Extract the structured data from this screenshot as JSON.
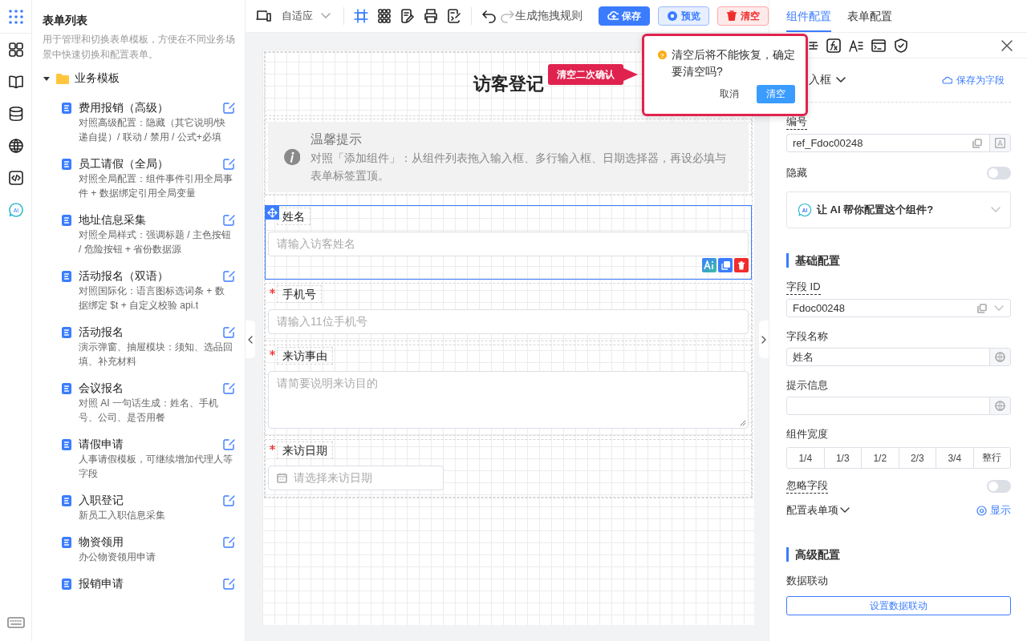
{
  "rail": {
    "ai_label": "AI"
  },
  "left_panel": {
    "title": "表单列表",
    "description": "用于管理和切换表单模板，方便在不同业务场景中快速切换和配置表单。",
    "folder": {
      "label": "业务模板",
      "expanded": true,
      "children": [
        {
          "title": "费用报销（高级）",
          "description": "对照高级配置：隐藏（其它说明/快递自提）/ 联动 / 禁用 / 公式+必填"
        },
        {
          "title": "员工请假（全局）",
          "description": "对照全局配置：组件事件引用全局事件 + 数据绑定引用全局变量"
        },
        {
          "title": "地址信息采集",
          "description": "对照全局样式：强调标题 / 主色按钮 / 危险按钮 + 省份数据源"
        },
        {
          "title": "活动报名（双语）",
          "description": "对照国际化：语言图标选词条 + 数据绑定 $t + 自定义校验 api.t"
        },
        {
          "title": "活动报名",
          "description": "演示弹窗、抽屉模块：须知、选品回填、补充材料"
        },
        {
          "title": "会议报名",
          "description": "对照 AI 一句话生成：姓名、手机号、公司、是否用餐"
        },
        {
          "title": "请假申请",
          "description": "人事请假模板，可继续增加代理人等字段"
        },
        {
          "title": "入职登记",
          "description": "新员工入职信息采集"
        },
        {
          "title": "物资领用",
          "description": "办公物资领用申请"
        },
        {
          "title": "报销申请"
        }
      ]
    }
  },
  "toolbar": {
    "layout_select": "自适应",
    "tools": [
      {
        "kind": "frame",
        "active": true
      },
      {
        "kind": "grid",
        "active": false
      },
      {
        "kind": "edit",
        "active": false
      },
      {
        "kind": "print",
        "active": false
      },
      {
        "kind": "script",
        "active": false
      }
    ],
    "history": [
      {
        "kind": "undo",
        "disabled": false
      },
      {
        "kind": "redo",
        "disabled": true
      }
    ],
    "generate_rule": "生成拖拽规则",
    "buttons": [
      {
        "kind": "save",
        "label": "保存"
      },
      {
        "kind": "preview",
        "label": "预览"
      },
      {
        "kind": "clear",
        "label": "清空"
      }
    ]
  },
  "form": {
    "title": "访客登记",
    "notice": {
      "title": "温馨提示",
      "text": "对照「添加组件」：从组件列表拖入输入框、多行输入框、日期选择器，再设必填与表单标签置顶。"
    },
    "fields": [
      {
        "kind": "input",
        "label": "姓名",
        "required": false,
        "selected": true,
        "placeholder": "请输入访客姓名"
      },
      {
        "kind": "input",
        "label": "手机号",
        "required": true,
        "selected": false,
        "placeholder": "请输入11位手机号"
      },
      {
        "kind": "textarea",
        "label": "来访事由",
        "required": true,
        "selected": false,
        "placeholder": "请简要说明来访目的"
      },
      {
        "kind": "date",
        "label": "来访日期",
        "required": true,
        "selected": false,
        "placeholder": "请选择来访日期"
      }
    ]
  },
  "popconfirm": {
    "icon": "?",
    "message": "清空后将不能恢复，确定要清空吗?",
    "cancel": "取消",
    "confirm": "清空"
  },
  "callout": "清空二次确认",
  "right_panel": {
    "tabs": [
      {
        "label": "组件配置",
        "selected": true
      },
      {
        "label": "表单配置",
        "selected": false
      }
    ],
    "component_type": "入框",
    "save_as_field": "保存为字段",
    "ref": {
      "label": "编号",
      "value": "ref_Fdoc00248"
    },
    "hidden": {
      "label": "隐藏",
      "on": false
    },
    "ai_icon_label": "AI",
    "ai_prompt": "让 AI 帮你配置这个组件?",
    "basic_section": "基础配置",
    "field_id": {
      "label": "字段 ID",
      "value": "Fdoc00248"
    },
    "field_name": {
      "label": "字段名称",
      "value": "姓名"
    },
    "hint": {
      "label": "提示信息"
    },
    "width": {
      "label": "组件宽度",
      "options": [
        {
          "label": "1/4",
          "selected": false
        },
        {
          "label": "1/3",
          "selected": false
        },
        {
          "label": "1/2",
          "selected": false
        },
        {
          "label": "2/3",
          "selected": false
        },
        {
          "label": "3/4",
          "selected": false
        },
        {
          "label": "整行",
          "selected": false
        }
      ]
    },
    "ignore": {
      "label": "忽略字段",
      "on": false
    },
    "form_item": {
      "label": "配置表单项",
      "show": "显示"
    },
    "advanced_section": "高级配置",
    "linkage": {
      "label": "数据联动",
      "button": "设置数据联动"
    }
  }
}
